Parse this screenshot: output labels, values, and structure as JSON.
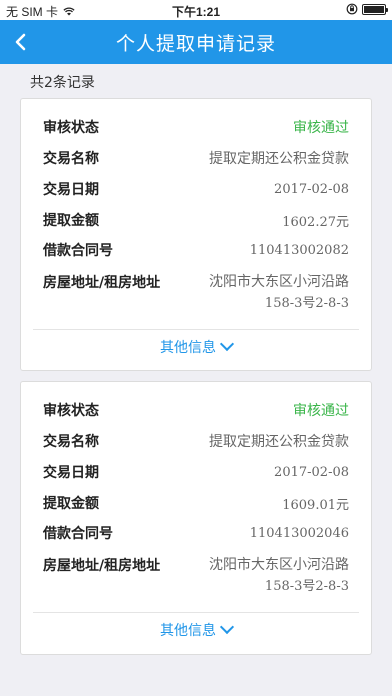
{
  "status_bar": {
    "carrier": "无 SIM 卡",
    "time": "下午1:21",
    "battery_level": 1.0
  },
  "nav": {
    "back_icon": "chevron-left-icon",
    "title": "个人提取申请记录"
  },
  "summary": {
    "count_text": "共2条记录"
  },
  "labels": {
    "status": "审核状态",
    "trade_name": "交易名称",
    "trade_date": "交易日期",
    "amount": "提取金额",
    "contract_no": "借款合同号",
    "address": "房屋地址/租房地址",
    "more": "其他信息"
  },
  "records": [
    {
      "status": "审核通过",
      "trade_name": "提取定期还公积金贷款",
      "trade_date": "2017-02-08",
      "amount": "1602.27元",
      "contract_no": "110413002082",
      "address_line1": "沈阳市大东区小河沿路",
      "address_line2": "158-3号2-8-3"
    },
    {
      "status": "审核通过",
      "trade_name": "提取定期还公积金贷款",
      "trade_date": "2017-02-08",
      "amount": "1609.01元",
      "contract_no": "110413002046",
      "address_line1": "沈阳市大东区小河沿路",
      "address_line2": "158-3号2-8-3"
    }
  ],
  "colors": {
    "accent": "#2196e8",
    "status_ok": "#3ab54a",
    "background": "#efeff4"
  }
}
